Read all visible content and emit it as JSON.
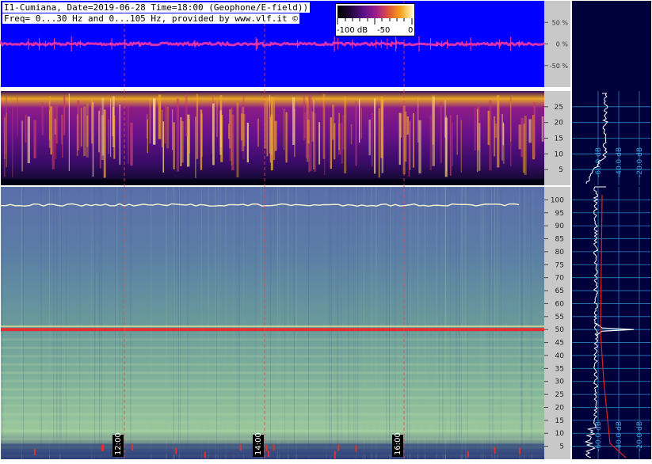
{
  "header": {
    "line1": "I1-Cumiana, Date=2019-06-28 Time=18:00 (Geophone/E-field))",
    "line2": "Freq= 0...30 Hz and 0...105 Hz, provided by www.vlf.it ©"
  },
  "colorbar": {
    "ticks": [
      "-100 dB",
      "-50",
      "0"
    ],
    "gradient": [
      "#000000",
      "#5a108a",
      "#e0543a",
      "#fff7c0"
    ]
  },
  "time_markers": [
    "12:00",
    "14:00",
    "16:00"
  ],
  "colors": {
    "background": "#ffffff",
    "top_panel": "#0000ff",
    "signal": "#ff3aa0",
    "spectrum_bg": "#00003a",
    "grid": "#3aa0e0",
    "spectrum_line": "#ffffff",
    "avg_line": "#e02020",
    "marker": "#e05050"
  },
  "chart_data": [
    {
      "type": "line",
      "name": "amplitude-panel",
      "y_ticks": [
        "50 %",
        "0 %",
        "-50 %"
      ],
      "ylim": [
        -100,
        100
      ]
    },
    {
      "type": "heatmap",
      "name": "spectrogram-0-30Hz",
      "y_ticks": [
        5,
        10,
        15,
        20,
        25
      ],
      "ylim": [
        0,
        30
      ]
    },
    {
      "type": "heatmap",
      "name": "spectrogram-0-105Hz",
      "y_ticks": [
        5,
        10,
        15,
        20,
        25,
        30,
        35,
        40,
        45,
        50,
        55,
        60,
        65,
        70,
        75,
        80,
        85,
        90,
        95,
        100
      ],
      "ylim": [
        0,
        105
      ],
      "notable_lines_hz": [
        50,
        98
      ]
    },
    {
      "type": "line",
      "name": "spectrum-0-30Hz",
      "x_ticks": [
        "-60.0 dB",
        "-40.0 dB",
        "-20.0 dB"
      ]
    },
    {
      "type": "line",
      "name": "spectrum-0-105Hz",
      "x_ticks": [
        "-60.0 dB",
        "-40.0 dB",
        "-20.0 dB"
      ],
      "peak_hz": 50
    }
  ]
}
